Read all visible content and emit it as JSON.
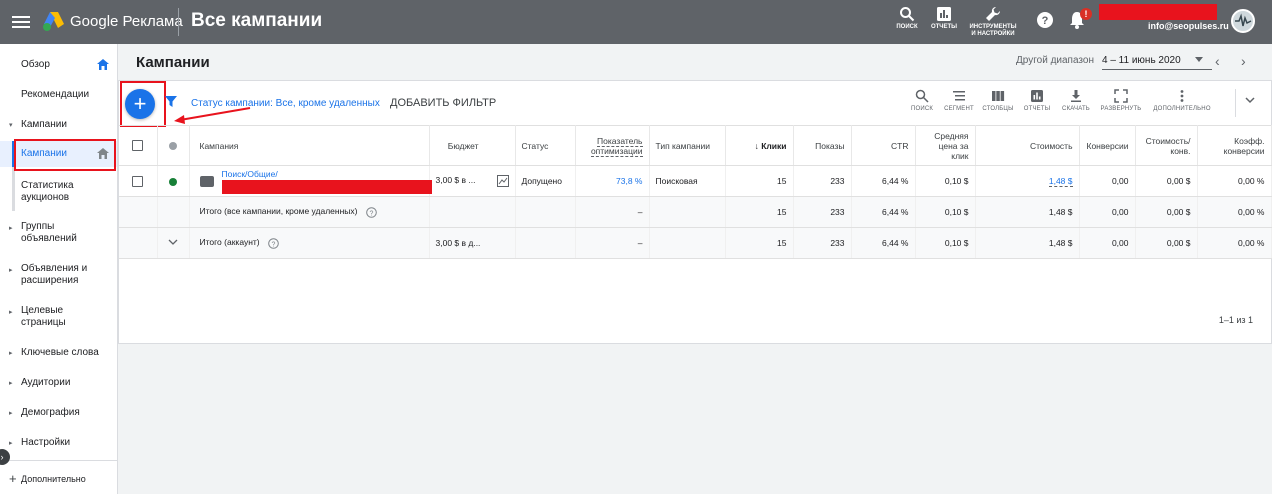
{
  "app": {
    "brand": "Google Реклама",
    "page_title": "Все кампании",
    "account_email": "info@seopulses.ru",
    "notification_badge": "!"
  },
  "top_actions": [
    {
      "label": "ПОИСК",
      "icon": "search-icon"
    },
    {
      "label": "ОТЧЕТЫ",
      "icon": "reports-icon"
    },
    {
      "label_line1": "ИНСТРУМЕНТЫ",
      "label_line2": "И НАСТРОЙКИ",
      "icon": "wrench-icon"
    },
    {
      "label": "",
      "icon": "help-icon"
    },
    {
      "label": "",
      "icon": "bell-icon"
    }
  ],
  "sidebar": {
    "items": [
      {
        "label": "Обзор"
      },
      {
        "label": "Рекомендации"
      },
      {
        "label": "Кампании"
      },
      {
        "label": "Кампании"
      },
      {
        "label": "Статистика аукционов"
      },
      {
        "label": "Группы объявлений"
      },
      {
        "label": "Объявления и расширения"
      },
      {
        "label": "Целевые страницы"
      },
      {
        "label": "Ключевые слова"
      },
      {
        "label": "Аудитории"
      },
      {
        "label": "Демография"
      },
      {
        "label": "Настройки"
      }
    ],
    "more": "Дополнительно"
  },
  "header": {
    "title": "Кампании",
    "range_label": "Другой диапазон",
    "range_value": "4 – 11 июнь 2020"
  },
  "toolbar": {
    "filter_prefix": "Статус кампании:",
    "filter_value": "Все, кроме удаленных",
    "add_filter": "ДОБАВИТЬ ФИЛЬТР",
    "tools": [
      "ПОИСК",
      "СЕГМЕНТ",
      "СТОЛБЦЫ",
      "ОТЧЕТЫ",
      "СКАЧАТЬ",
      "РАЗВЕРНУТЬ",
      "ДОПОЛНИТЕЛЬНО"
    ]
  },
  "table": {
    "columns": [
      "Кампания",
      "Бюджет",
      "Статус",
      "Показатель оптимизации",
      "Тип кампании",
      "Клики",
      "Показы",
      "CTR",
      "Средняя цена за клик",
      "Стоимость",
      "Конверсии",
      "Стоимость/конв.",
      "Коэфф. конверсии"
    ],
    "rows": [
      {
        "campaign": "Поиск/Общие/",
        "budget": "3,00 $ в ...",
        "status": "Допущено",
        "optimization": "73,8 %",
        "type": "Поисковая",
        "clicks": "15",
        "impressions": "233",
        "ctr": "6,44 %",
        "avg_cpc": "0,10 $",
        "cost": "1,48 $",
        "conversions": "0,00",
        "cost_per_conv": "0,00 $",
        "conv_rate": "0,00 %"
      }
    ],
    "totals": [
      {
        "label": "Итого (все кампании, кроме удаленных)",
        "budget": "",
        "optimization": "–",
        "clicks": "15",
        "impressions": "233",
        "ctr": "6,44 %",
        "avg_cpc": "0,10 $",
        "cost": "1,48 $",
        "conversions": "0,00",
        "cost_per_conv": "0,00 $",
        "conv_rate": "0,00 %"
      },
      {
        "label": "Итого (аккаунт)",
        "budget": "3,00 $ в д...",
        "optimization": "–",
        "clicks": "15",
        "impressions": "233",
        "ctr": "6,44 %",
        "avg_cpc": "0,10 $",
        "cost": "1,48 $",
        "conversions": "0,00",
        "cost_per_conv": "0,00 $",
        "conv_rate": "0,00 %"
      }
    ],
    "pagination": "1–1 из 1"
  },
  "colors": {
    "topbar": "#5f6368",
    "accent": "#1a73e8",
    "status_enabled": "#188038",
    "highlight": "#e8131d"
  }
}
